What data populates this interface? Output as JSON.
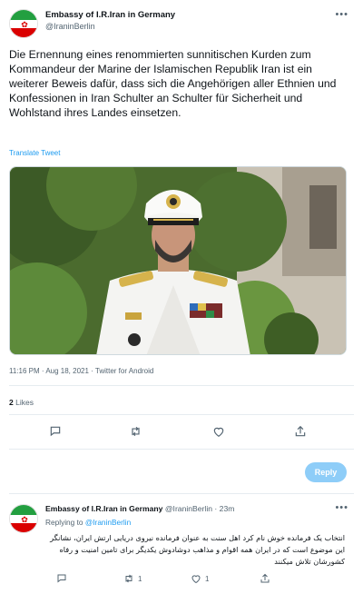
{
  "tweet": {
    "author_name": "Embassy of I.R.Iran in Germany",
    "author_handle": "@IraninBerlin",
    "text": "Die Ernennung eines renommierten sunnitischen Kurden zum Kommandeur der Marine der Islamischen Republik Iran ist ein weiterer Beweis dafür, dass sich die Angehörigen aller Ethnien und Konfessionen in Iran Schulter an Schulter für Sicherheit und Wohlstand ihres Landes einsetzen.",
    "translate_label": "Translate Tweet",
    "timestamp": "11:16 PM · Aug 18, 2021 · Twitter for Android",
    "likes_count": "2",
    "likes_label": "Likes",
    "reply_button_label": "Reply"
  },
  "reply": {
    "author_name": "Embassy of I.R.Iran in Germany",
    "author_handle": "@IraninBerlin",
    "time": "· 23m",
    "replying_to_label": "Replying to",
    "replying_to_handle": "@IraninBerlin",
    "text": "انتخاب یک فرمانده خوش نام کرد اهل سنت به عنوان فرمانده نیروی دریایی ارتش ایران، نشانگر این موضوع است که در ایران همه اقوام و مذاهب دوشادوش یکدیگر برای تامین امنیت و رفاه کشورشان تلاش میکنند",
    "retweet_count": "1",
    "like_count": "1"
  },
  "icons": {
    "more": "more-horizontal-icon",
    "reply": "comment-icon",
    "retweet": "retweet-icon",
    "like": "heart-icon",
    "share": "share-icon"
  },
  "colors": {
    "accent": "#1d9bf0",
    "reply_button": "#8ecdf8",
    "muted": "#536471"
  }
}
